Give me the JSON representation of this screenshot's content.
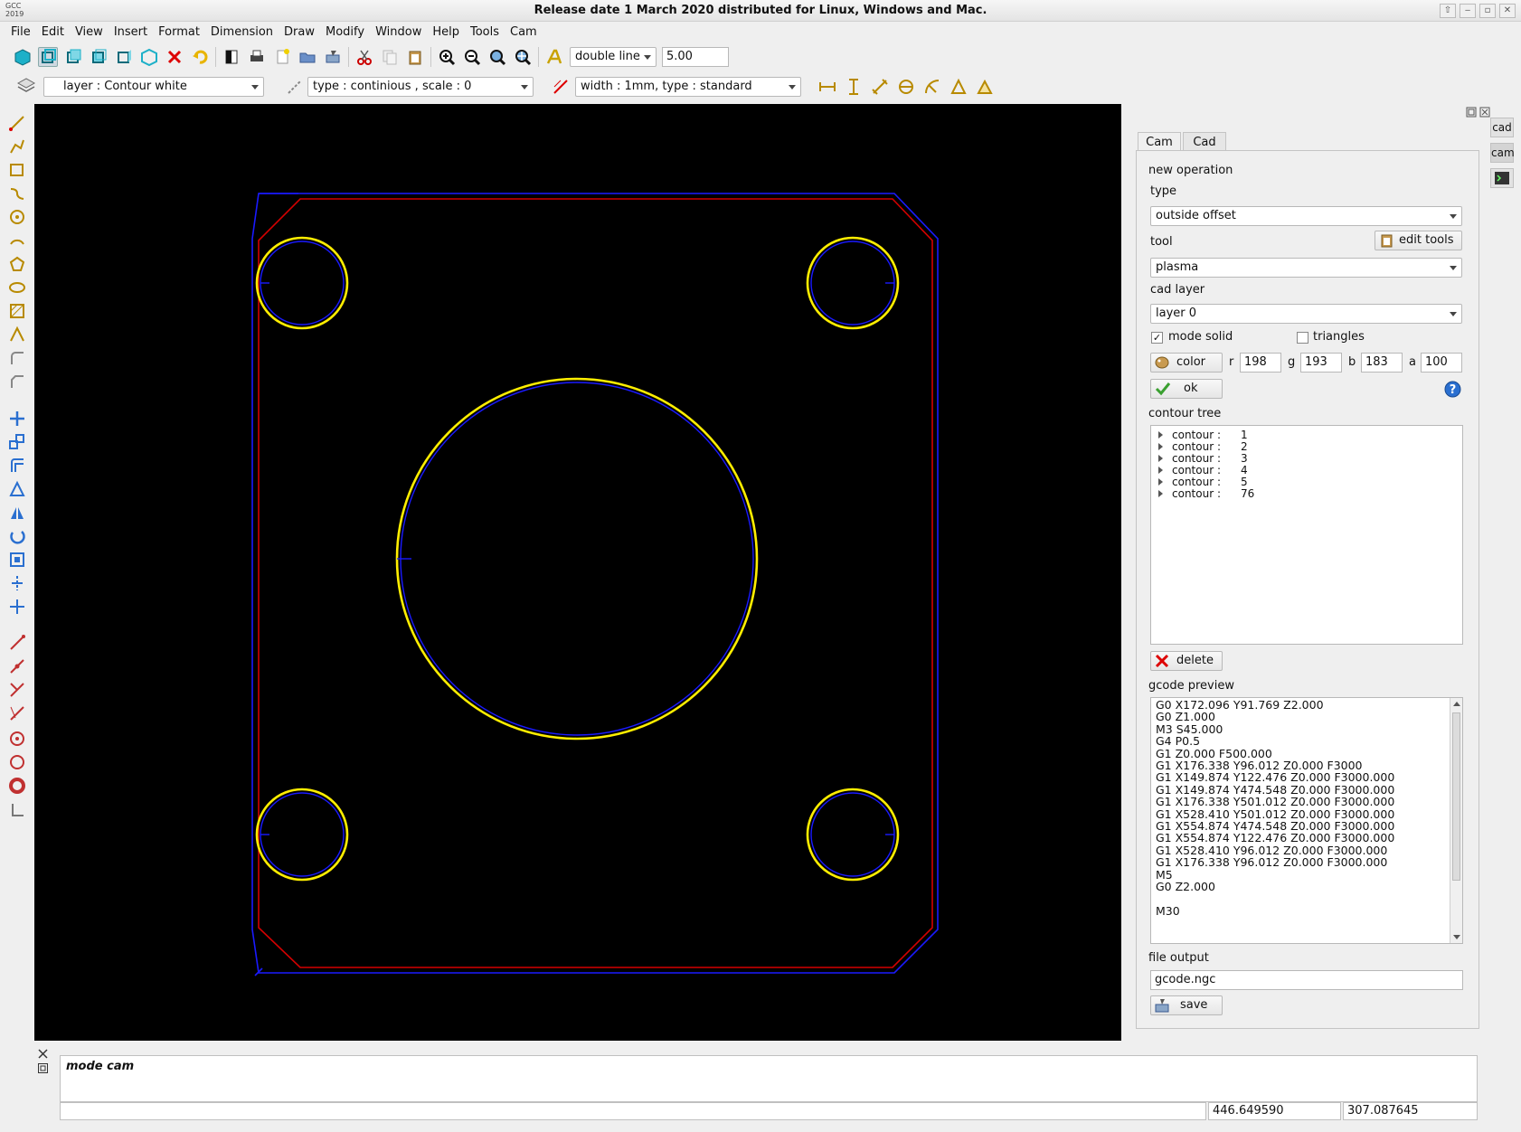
{
  "window": {
    "title": "Release date 1 March 2020 distributed for Linux, Windows and Mac.",
    "logo_line1": "GCC",
    "logo_line2": "2019"
  },
  "menu": [
    "File",
    "Edit",
    "View",
    "Insert",
    "Format",
    "Dimension",
    "Draw",
    "Modify",
    "Window",
    "Help",
    "Tools",
    "Cam"
  ],
  "toolbar": {
    "text_style": "double line",
    "text_height": "5.00"
  },
  "properties_bar": {
    "layer": "layer : Contour white",
    "linetype": "type : continious , scale : 0",
    "lineweight": "width : 1mm, type : standard"
  },
  "right_dock": {
    "cad_label": "cad",
    "cam_label": "cam"
  },
  "panel": {
    "tabs": [
      "Cam",
      "Cad"
    ],
    "active_tab": "Cam",
    "new_operation_label": "new operation",
    "type_label": "type",
    "type_value": "outside offset",
    "tool_label": "tool",
    "edit_tools_label": "edit tools",
    "tool_value": "plasma",
    "cad_layer_label": "cad layer",
    "cad_layer_value": "layer 0",
    "mode_solid_label": "mode solid",
    "mode_solid_checked": true,
    "triangles_label": "triangles",
    "triangles_checked": false,
    "color_label": "color",
    "r_label": "r",
    "r_value": "198",
    "g_label": "g",
    "g_value": "193",
    "b_label": "b",
    "b_value": "183",
    "a_label": "a",
    "a_value": "100",
    "ok_label": "ok",
    "contour_tree_label": "contour tree",
    "contours": [
      {
        "label": "contour :",
        "id": "1"
      },
      {
        "label": "contour :",
        "id": "2"
      },
      {
        "label": "contour :",
        "id": "3"
      },
      {
        "label": "contour :",
        "id": "4"
      },
      {
        "label": "contour :",
        "id": "5"
      },
      {
        "label": "contour :",
        "id": "76"
      }
    ],
    "delete_label": "delete",
    "gcode_preview_label": "gcode preview",
    "gcode_lines": [
      "G0 X172.096 Y91.769 Z2.000",
      "G0 Z1.000",
      "M3 S45.000",
      "G4 P0.5",
      "G1 Z0.000 F500.000",
      "G1 X176.338 Y96.012 Z0.000 F3000",
      "G1 X149.874 Y122.476 Z0.000 F3000.000",
      "G1 X149.874 Y474.548 Z0.000 F3000.000",
      "G1 X176.338 Y501.012 Z0.000 F3000.000",
      "G1 X528.410 Y501.012 Z0.000 F3000.000",
      "G1 X554.874 Y474.548 Z0.000 F3000.000",
      "G1 X554.874 Y122.476 Z0.000 F3000.000",
      "G1 X528.410 Y96.012 Z0.000 F3000.000",
      "G1 X176.338 Y96.012 Z0.000 F3000.000",
      "M5",
      "G0 Z2.000",
      "",
      "M30"
    ],
    "file_output_label": "file output",
    "file_output_value": "gcode.ngc",
    "save_label": "save"
  },
  "console": {
    "mode_text": "mode cam"
  },
  "status": {
    "x": "446.649590",
    "y": "307.087645"
  },
  "colors": {
    "canvas_bg": "#000000",
    "outer_contour": "#d40000",
    "toolpath": "#1a1aff",
    "circles": "#ffee00"
  }
}
